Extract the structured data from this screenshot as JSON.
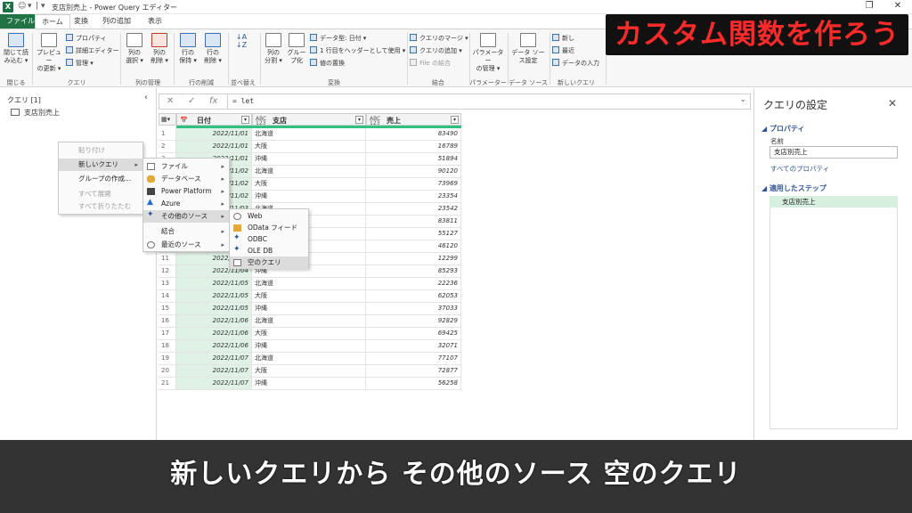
{
  "window": {
    "title": "支店別売上 - Power Query エディター",
    "app_badge": "X",
    "quick_access": [
      "☺",
      "▾",
      "|",
      "▾"
    ],
    "controls": {
      "restore": "❐",
      "close": "✕"
    }
  },
  "tabs": [
    {
      "label": "ファイル"
    },
    {
      "label": "ホーム"
    },
    {
      "label": "変換"
    },
    {
      "label": "列の追加"
    },
    {
      "label": "表示"
    }
  ],
  "ribbon": {
    "close_load": "閉じて読\nみ込む ▾",
    "preview_refresh": "プレビュー\nの更新 ▾",
    "properties": "プロパティ",
    "advanced_editor": "詳細エディター",
    "manage": "管理 ▾",
    "choose_columns": "列の\n選択 ▾",
    "remove_columns": "列の\n削除 ▾",
    "keep_rows": "行の\n保持 ▾",
    "remove_rows": "行の\n削除 ▾",
    "sort": "↓A\n↓Z",
    "split_column": "列の\n分割 ▾",
    "group_by": "グルー\nプ化",
    "data_type": "データ型: 日付 ▾",
    "first_row_header": "1 行目をヘッダーとして使用 ▾",
    "replace_values": "値の置換",
    "merge_queries": "クエリのマージ ▾",
    "append_queries": "クエリの追加 ▾",
    "combine_files": "File の結合",
    "manage_parameters": "パラメーター\nの管理 ▾",
    "data_source_settings": "データ ソー\nス設定",
    "new_source": "新し",
    "recent_sources": "最近",
    "enter_data": "データの入力",
    "groups": {
      "close": "閉じる",
      "query": "クエリ",
      "manage_columns": "列の管理",
      "reduce_rows": "行の削減",
      "sort": "並べ替え",
      "transform": "変換",
      "combine": "結合",
      "parameters": "パラメーター",
      "data_source": "データ ソース",
      "new_query": "新しいクエリ"
    }
  },
  "heading": "カスタム関数を作ろう",
  "queries_pane": {
    "header": "クエリ [1]",
    "collapse": "‹",
    "items": [
      "支店別売上"
    ]
  },
  "formula_bar": {
    "cancel": "✕",
    "commit": "✓",
    "fx": "fx",
    "text": "= let",
    "expand": "⌄"
  },
  "grid": {
    "columns": [
      {
        "type": "📅",
        "name": "日付"
      },
      {
        "type": "ABC\n123",
        "name": "支店"
      },
      {
        "type": "ABC\n123",
        "name": "売上"
      }
    ],
    "header_menu": "▦▾",
    "dropdown": "▾",
    "rows": [
      [
        "1",
        "2022/11/01",
        "北海道",
        "83490"
      ],
      [
        "2",
        "2022/11/01",
        "大阪",
        "16789"
      ],
      [
        "3",
        "2022/11/01",
        "沖縄",
        "51894"
      ],
      [
        "4",
        "2022/11/02",
        "北海道",
        "90120"
      ],
      [
        "5",
        "2022/11/02",
        "大阪",
        "73969"
      ],
      [
        "6",
        "2022/11/02",
        "沖縄",
        "23354"
      ],
      [
        "7",
        "2022/11/03",
        "北海道",
        "23542"
      ],
      [
        "8",
        "2022/11/03",
        "大阪",
        "83811"
      ],
      [
        "9",
        "2022/11/03",
        "沖縄",
        "55127"
      ],
      [
        "10",
        "2022/11/04",
        "北海道",
        "46120"
      ],
      [
        "11",
        "2022/11/04",
        "大阪",
        "12299"
      ],
      [
        "12",
        "2022/11/04",
        "沖縄",
        "85293"
      ],
      [
        "13",
        "2022/11/05",
        "北海道",
        "22236"
      ],
      [
        "14",
        "2022/11/05",
        "大阪",
        "62053"
      ],
      [
        "15",
        "2022/11/05",
        "沖縄",
        "37033"
      ],
      [
        "16",
        "2022/11/06",
        "北海道",
        "92829"
      ],
      [
        "17",
        "2022/11/06",
        "大阪",
        "69425"
      ],
      [
        "18",
        "2022/11/06",
        "沖縄",
        "32071"
      ],
      [
        "19",
        "2022/11/07",
        "北海道",
        "77107"
      ],
      [
        "20",
        "2022/11/07",
        "大阪",
        "72877"
      ],
      [
        "21",
        "2022/11/07",
        "沖縄",
        "56258"
      ]
    ]
  },
  "settings_pane": {
    "title": "クエリの設定",
    "close": "✕",
    "properties_section": "◢ プロパティ",
    "name_label": "名前",
    "name_value": "支店別売上",
    "all_properties": "すべてのプロパティ",
    "steps_section": "◢ 適用したステップ",
    "steps": [
      "支店別売上"
    ]
  },
  "context_menu": {
    "items": [
      {
        "label": "貼り付け",
        "disabled": true
      },
      {
        "label": "新しいクエリ",
        "submenu": true
      },
      {
        "label": "グループの作成...",
        "disabled": false
      },
      {
        "label": "すべて展開",
        "disabled": true
      },
      {
        "label": "すべて折りたたむ",
        "disabled": true
      }
    ]
  },
  "new_query_menu": {
    "items": [
      {
        "label": "ファイル",
        "icon": "file-icon",
        "submenu": true
      },
      {
        "label": "データベース",
        "icon": "database-icon",
        "submenu": true
      },
      {
        "label": "Power Platform",
        "icon": "power-platform-icon",
        "submenu": true
      },
      {
        "label": "Azure",
        "icon": "azure-icon",
        "submenu": true
      },
      {
        "label": "その他のソース",
        "icon": "other-sources-icon",
        "submenu": true
      },
      {
        "label": "結合",
        "icon": "",
        "submenu": true
      },
      {
        "label": "最近のソース",
        "icon": "recent-sources-icon",
        "submenu": true
      }
    ]
  },
  "other_sources_menu": {
    "items": [
      {
        "label": "Web",
        "icon": "globe-icon"
      },
      {
        "label": "OData フィード",
        "icon": "odata-icon"
      },
      {
        "label": "ODBC",
        "icon": "odbc-icon"
      },
      {
        "label": "OLE DB",
        "icon": "oledb-icon"
      },
      {
        "label": "空のクエリ",
        "icon": "blank-query-icon"
      }
    ]
  },
  "caption": "新しいクエリから その他のソース 空のクエリ",
  "colors": {
    "excel_green": "#217346",
    "heading_red": "#ff2a2a",
    "accent_blue": "#2f5597",
    "date_column_fill": "#dff2e5",
    "column_bar": "#2ec27e"
  }
}
